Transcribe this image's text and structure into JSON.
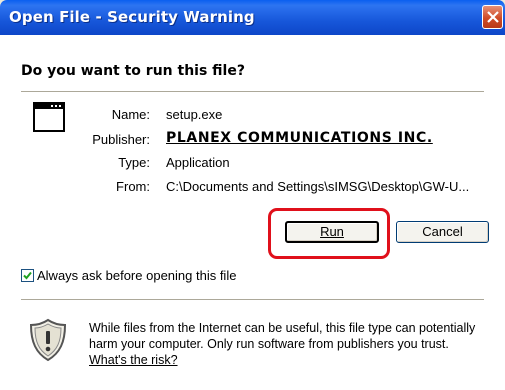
{
  "window": {
    "title": "Open File - Security Warning"
  },
  "dialog": {
    "question": "Do you want to run this file?",
    "fields": [
      {
        "label": "Name:",
        "value": "setup.exe"
      },
      {
        "label": "Publisher:",
        "value": "PLANEX COMMUNICATIONS INC."
      },
      {
        "label": "Type:",
        "value": "Application"
      },
      {
        "label": "From:",
        "value": "C:\\Documents and Settings\\sIMSG\\Desktop\\GW-U..."
      }
    ],
    "run_label": "Run",
    "cancel_label": "Cancel",
    "checkbox": {
      "label": "Always ask before opening this file",
      "checked": true
    },
    "warning_text": "While files from the Internet can be useful, this file type can potentially harm your computer. Only run software from publishers you trust.",
    "risk_link": "What's the risk?"
  },
  "colors": {
    "titlebar": "#0a5ff0",
    "highlight": "#e0101b",
    "dialog_bg": "#ece9d8"
  },
  "icons": [
    "close-icon",
    "application-icon",
    "checkmark-icon",
    "shield-warning-icon"
  ]
}
